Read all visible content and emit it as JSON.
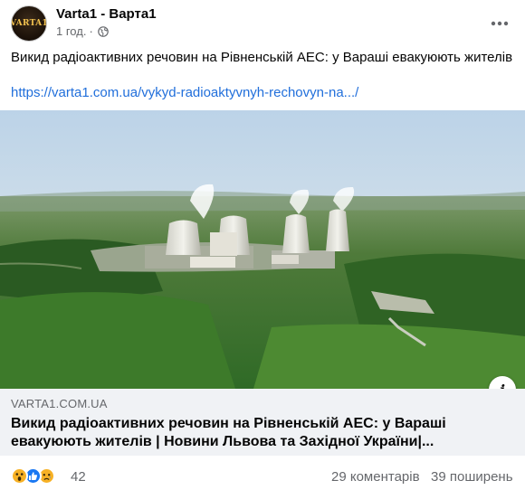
{
  "post": {
    "page_name": "Varta1 - Варта1",
    "time": "1 год.",
    "separator": "·",
    "avatar_text": "VARTA1",
    "text": "Викид радіоактивних речовин на Рівненській АЕС: у Вараші евакуюють жителів",
    "link": "https://varta1.com.ua/vykyd-radioaktyvnyh-rechovyn-na.../"
  },
  "link_preview": {
    "domain": "VARTA1.COM.UA",
    "title": "Викид радіоактивних речовин на Рівненській АЕС: у Вараші евакуюють жителів | Новини Львова та Західної України|...",
    "info_label": "i",
    "image_subject": "aerial view of nuclear power plant cooling towers among green forest"
  },
  "footer": {
    "reactions": [
      "wow-reaction-icon",
      "like-reaction-icon",
      "sad-reaction-icon"
    ],
    "reaction_count": "42",
    "comments": "29 коментарів",
    "shares": "39 поширень"
  },
  "colors": {
    "link": "#216fdb",
    "secondary_text": "#65676b",
    "card_bg": "#f0f2f5",
    "like_blue": "#1877f2",
    "reaction_yellow": "#f7b125"
  }
}
